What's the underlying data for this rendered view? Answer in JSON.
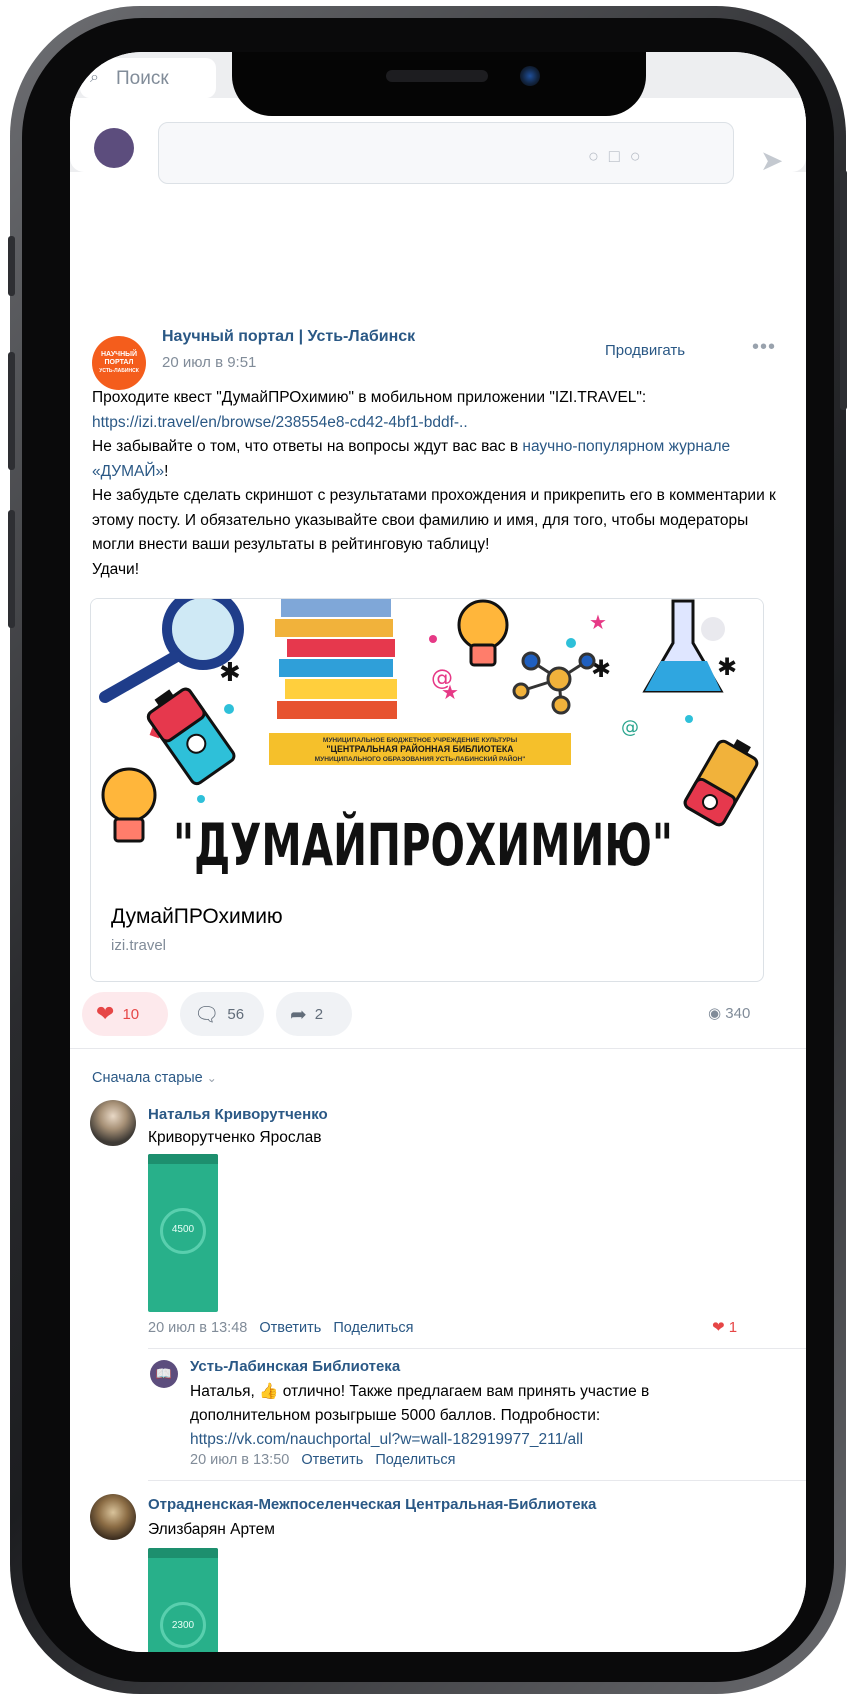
{
  "search": {
    "placeholder": "Поиск"
  },
  "post": {
    "author": "Научный портал | Усть-Лабинск",
    "date": "20 июл в 9:51",
    "promote_label": "Продвигать",
    "avatar_lines": [
      "НАУЧНЫЙ",
      "ПОРТАЛ",
      "УСТЬ-ЛАБИНСК"
    ],
    "text_line1": "Проходите квест \"ДумайПРОхимию\" в мобильном приложении \"IZI.TRAVEL\":",
    "link1": "https://izi.travel/en/browse/238554e8-cd42-4bf1-bddf-..",
    "text_line3a": "Не забывайте о том, что ответы на вопросы ждут вас вас в ",
    "link2": "научно-популярном журнале «ДУМАЙ»",
    "text_line3b": "!",
    "text_line4": "Не забудьте сделать скриншот с результатами прохождения и прикрепить его в комментарии к этому посту. И обязательно указывайте свои фамилию и имя, для того, чтобы модераторы могли внести ваши результаты в рейтинговую таблицу!",
    "text_line5": "Удачи!"
  },
  "card": {
    "banner_line1": "МУНИЦИПАЛЬНОЕ БЮДЖЕТНОЕ УЧРЕЖДЕНИЕ КУЛЬТУРЫ",
    "banner_line2": "\"ЦЕНТРАЛЬНАЯ РАЙОННАЯ БИБЛИОТЕКА",
    "banner_line3": "МУНИЦИПАЛЬНОГО ОБРАЗОВАНИЯ УСТЬ-ЛАБИНСКИЙ РАЙОН\"",
    "big_title": "\"ДУМАЙПРОХИМИЮ\"",
    "title": "ДумайПРОхимию",
    "domain": "izi.travel"
  },
  "actions": {
    "likes": "10",
    "comments": "56",
    "shares": "2",
    "views": "340"
  },
  "comments_sort": "Сначала старые",
  "comments": [
    {
      "author": "Наталья Криворутченко",
      "text": "Криворутченко Ярослав",
      "shot_value": "4500",
      "meta_date": "20 июл в 13:48",
      "reply_label": "Ответить",
      "share_label": "Поделиться",
      "likes": "1"
    },
    {
      "author": "Усть-Лабинская Библиотека",
      "text_a": "Наталья,",
      "text_b": "отлично! Также предлагаем вам принять участие в дополнительном розыгрыше 5000 баллов. Подробности:",
      "link": "https://vk.com/nauchportal_ul?w=wall-182919977_211/all",
      "meta_date": "20 июл в 13:50",
      "reply_label": "Ответить",
      "share_label": "Поделиться"
    },
    {
      "author": "Отрадненская-Межпоселенческая Центральная-Библиотека",
      "text": "Элизбарян Артем",
      "shot_value": "2300"
    }
  ],
  "colors": {
    "link": "#2a5885",
    "like": "#e64646",
    "meta": "#818c99"
  }
}
